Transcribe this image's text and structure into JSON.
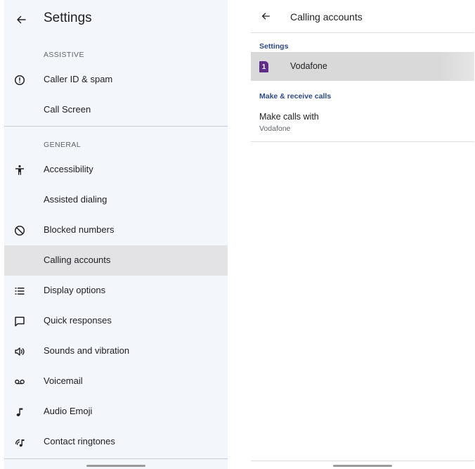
{
  "left": {
    "title": "Settings",
    "sections": {
      "assistive": "ASSISTIVE",
      "general": "GENERAL"
    },
    "items": [
      {
        "label": "Caller ID & spam",
        "icon": "info-circle-icon"
      },
      {
        "label": "Call Screen",
        "icon": ""
      },
      {
        "label": "Accessibility",
        "icon": "accessibility-icon"
      },
      {
        "label": "Assisted dialing",
        "icon": ""
      },
      {
        "label": "Blocked numbers",
        "icon": "block-icon"
      },
      {
        "label": "Calling accounts",
        "icon": "",
        "selected": true
      },
      {
        "label": "Display options",
        "icon": "list-icon"
      },
      {
        "label": "Quick responses",
        "icon": "chat-bubble-icon"
      },
      {
        "label": "Sounds and vibration",
        "icon": "speaker-icon"
      },
      {
        "label": "Voicemail",
        "icon": "voicemail-icon"
      },
      {
        "label": "Audio Emoji",
        "icon": "music-note-icon"
      },
      {
        "label": "Contact ringtones",
        "icon": "ringtone-icon"
      }
    ]
  },
  "right": {
    "title": "Calling accounts",
    "section_settings": "Settings",
    "account": {
      "sim_number": "1",
      "name": "Vodafone"
    },
    "section_calls": "Make & receive calls",
    "make_calls": {
      "title": "Make calls with",
      "value": "Vodafone"
    }
  },
  "colors": {
    "left_bg": "#f3f6fb",
    "selected_bg": "#e3e3e5",
    "section_accent": "#2c4a86",
    "sim_purple": "#5e2d8c"
  }
}
